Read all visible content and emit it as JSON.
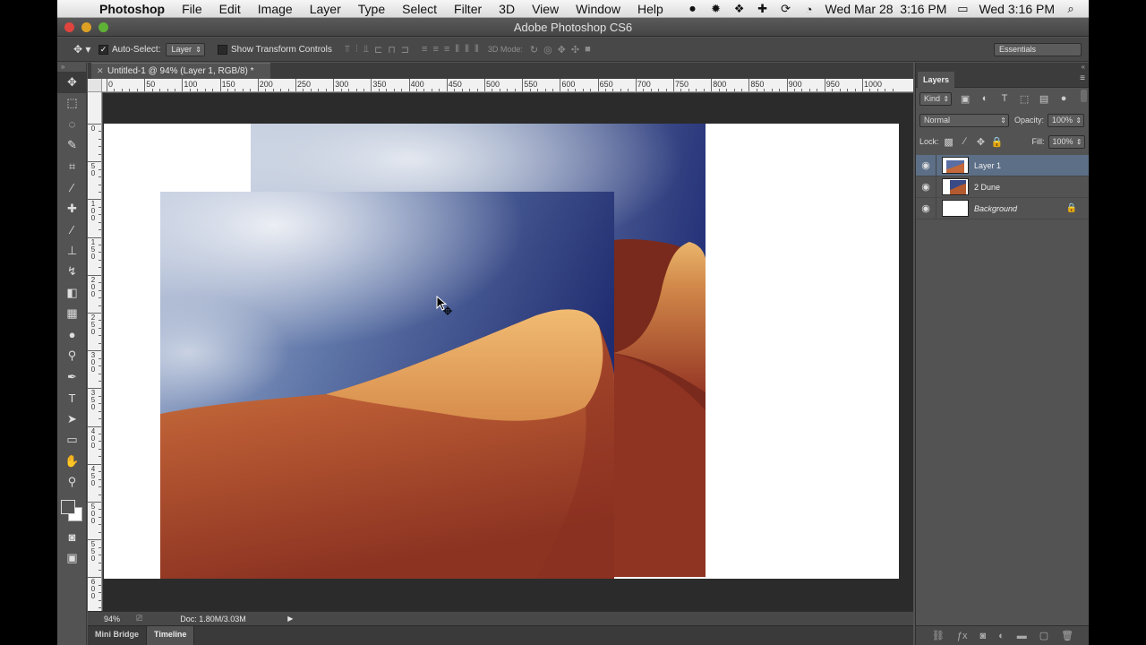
{
  "menubar": {
    "apple": "",
    "app_name": "Photoshop",
    "items": [
      "File",
      "Edit",
      "Image",
      "Layer",
      "Type",
      "Select",
      "Filter",
      "3D",
      "View",
      "Window",
      "Help"
    ],
    "clock_long": "Wed Mar 28  3:16 PM",
    "clock_short": "Wed 3:16 PM",
    "tray_icons": [
      "screen-record-icon",
      "brightness-icon",
      "dropbox-icon",
      "crosshair-icon",
      "sync-icon",
      "wifi-icon",
      "battery-icon",
      "spotlight-icon"
    ]
  },
  "titlebar": {
    "title": "Adobe Photoshop CS6"
  },
  "options": {
    "auto_select_label": "Auto-Select:",
    "auto_select_value": "Layer",
    "show_transform_label": "Show Transform Controls",
    "mode_3d_label": "3D Mode:",
    "workspace": "Essentials"
  },
  "document": {
    "tab_title": "Untitled-1 @ 94% (Layer 1, RGB/8) *",
    "zoom": "94%",
    "doc_size": "Doc: 1.80M/3.03M"
  },
  "rulers": {
    "h_labels": [
      "0",
      "50",
      "100",
      "150",
      "200",
      "250",
      "300",
      "350",
      "400",
      "450",
      "500",
      "550",
      "600",
      "650",
      "700",
      "750",
      "800",
      "850",
      "900",
      "950",
      "1000"
    ],
    "v_labels": [
      "0",
      "5\n0",
      "1\n0\n0",
      "1\n5\n0",
      "2\n0\n0",
      "2\n5\n0",
      "3\n0\n0",
      "3\n5\n0",
      "4\n0\n0",
      "4\n5\n0",
      "5\n0\n0",
      "5\n5\n0",
      "6\n0\n0"
    ]
  },
  "bottom_tabs": [
    "Mini Bridge",
    "Timeline"
  ],
  "layers_panel": {
    "tab": "Layers",
    "kind_label": "Kind",
    "blend_mode": "Normal",
    "opacity_label": "Opacity:",
    "opacity_value": "100%",
    "lock_label": "Lock:",
    "fill_label": "Fill:",
    "fill_value": "100%",
    "layers": [
      {
        "name": "Layer 1",
        "selected": true
      },
      {
        "name": "2 Dune",
        "selected": false
      },
      {
        "name": "Background",
        "selected": false
      }
    ]
  },
  "colors": {
    "ui_bg": "#535353",
    "selection": "#5c6f87",
    "sky_dark": "#2d3f78",
    "sand_light": "#e4a55a",
    "sand_dark": "#9a3a22"
  }
}
